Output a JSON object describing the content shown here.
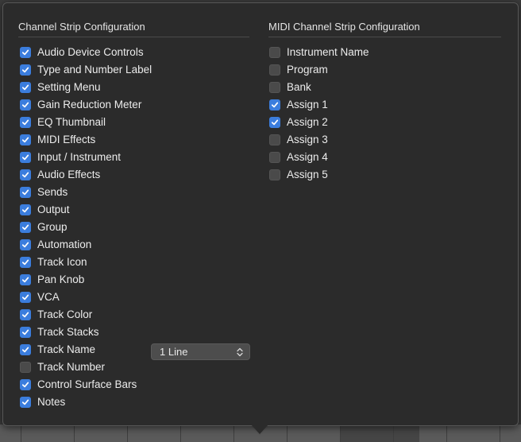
{
  "left_section": {
    "title": "Channel Strip Configuration",
    "items": [
      {
        "label": "Audio Device Controls",
        "checked": true
      },
      {
        "label": "Type and Number Label",
        "checked": true
      },
      {
        "label": "Setting Menu",
        "checked": true
      },
      {
        "label": "Gain Reduction Meter",
        "checked": true
      },
      {
        "label": "EQ Thumbnail",
        "checked": true
      },
      {
        "label": "MIDI Effects",
        "checked": true
      },
      {
        "label": "Input / Instrument",
        "checked": true
      },
      {
        "label": "Audio Effects",
        "checked": true
      },
      {
        "label": "Sends",
        "checked": true
      },
      {
        "label": "Output",
        "checked": true
      },
      {
        "label": "Group",
        "checked": true
      },
      {
        "label": "Automation",
        "checked": true
      },
      {
        "label": "Track Icon",
        "checked": true
      },
      {
        "label": "Pan Knob",
        "checked": true
      },
      {
        "label": "VCA",
        "checked": true
      },
      {
        "label": "Track Color",
        "checked": true
      },
      {
        "label": "Track Stacks",
        "checked": true
      },
      {
        "label": "Track Name",
        "checked": true
      },
      {
        "label": "Track Number",
        "checked": false
      },
      {
        "label": "Control Surface Bars",
        "checked": true
      },
      {
        "label": "Notes",
        "checked": true
      }
    ]
  },
  "track_name_popup": {
    "value": "1 Line",
    "icon": "chevron-up-down-icon"
  },
  "right_section": {
    "title": "MIDI Channel Strip Configuration",
    "items": [
      {
        "label": "Instrument Name",
        "checked": false
      },
      {
        "label": "Program",
        "checked": false
      },
      {
        "label": "Bank",
        "checked": false
      },
      {
        "label": "Assign 1",
        "checked": true
      },
      {
        "label": "Assign 2",
        "checked": true
      },
      {
        "label": "Assign 3",
        "checked": false
      },
      {
        "label": "Assign 4",
        "checked": false
      },
      {
        "label": "Assign 5",
        "checked": false
      }
    ]
  },
  "colors": {
    "checkbox_on": "#3b7ddd",
    "popover_bg": "#2b2b2b",
    "text": "#ececec"
  }
}
